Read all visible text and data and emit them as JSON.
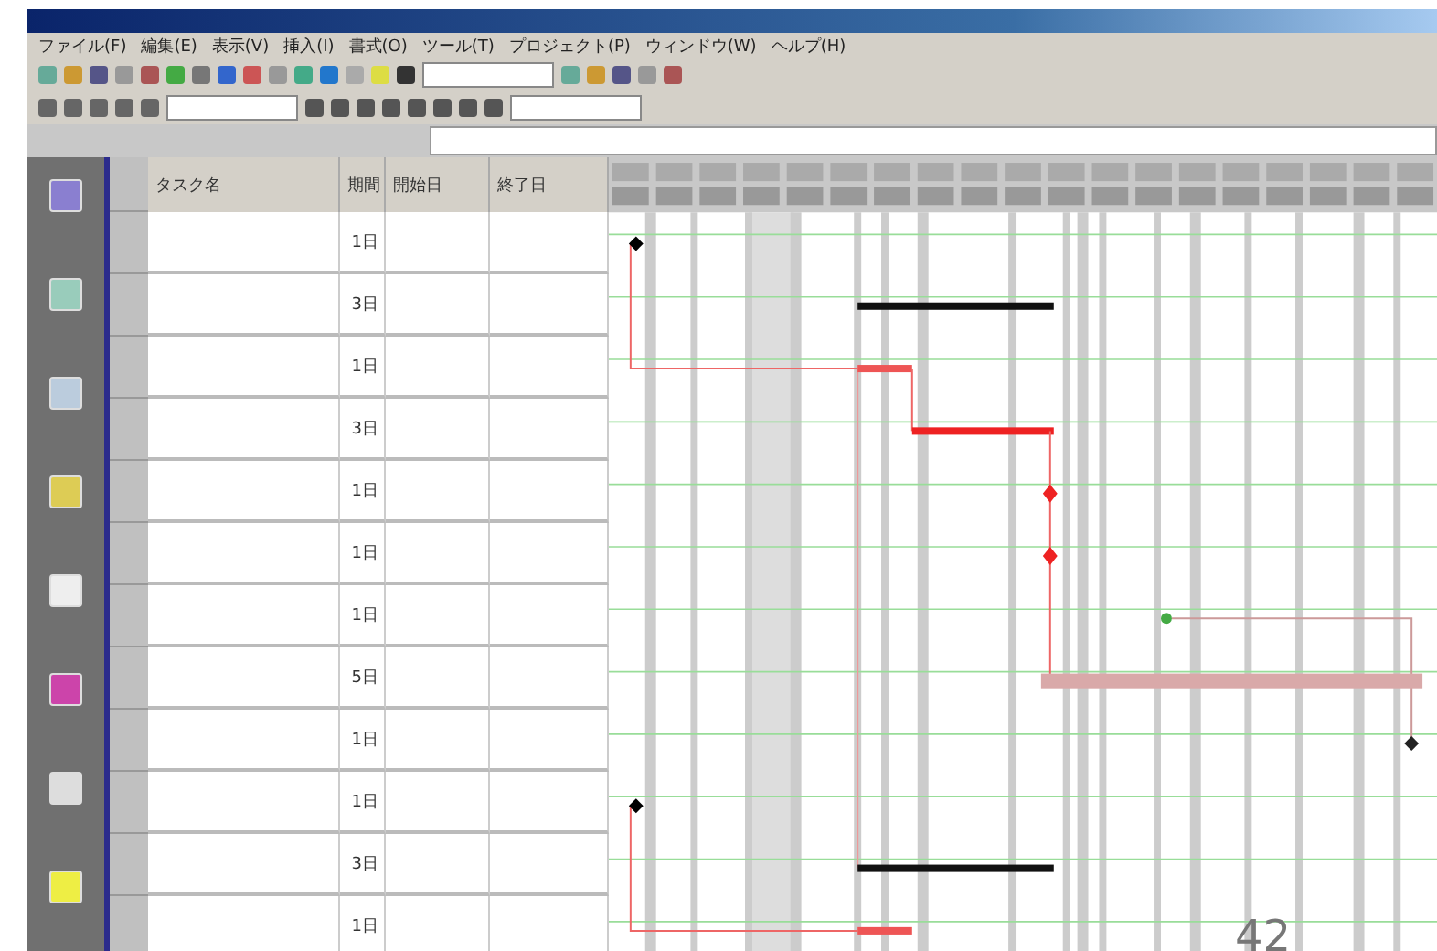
{
  "menu": [
    "ファイル(F)",
    "編集(E)",
    "表示(V)",
    "挿入(I)",
    "書式(O)",
    "ツール(T)",
    "プロジェクト(P)",
    "ウィンドウ(W)",
    "ヘルプ(H)"
  ],
  "table": {
    "columns": [
      "タスク名",
      "期間",
      "開始日",
      "終了日"
    ],
    "rows": [
      {
        "duration": "1日"
      },
      {
        "duration": "3日",
        "children": [
          {
            "duration": "1日"
          },
          {
            "duration": "3日"
          },
          {
            "duration": "1日"
          },
          {
            "duration": "1日"
          }
        ]
      },
      {
        "duration": "1日"
      },
      {
        "duration": "5日"
      },
      {
        "duration": "1日"
      },
      {
        "duration": "1日"
      },
      {
        "duration": "3日",
        "children": [
          {
            "duration": "1日"
          }
        ]
      }
    ]
  },
  "page_number": "42"
}
